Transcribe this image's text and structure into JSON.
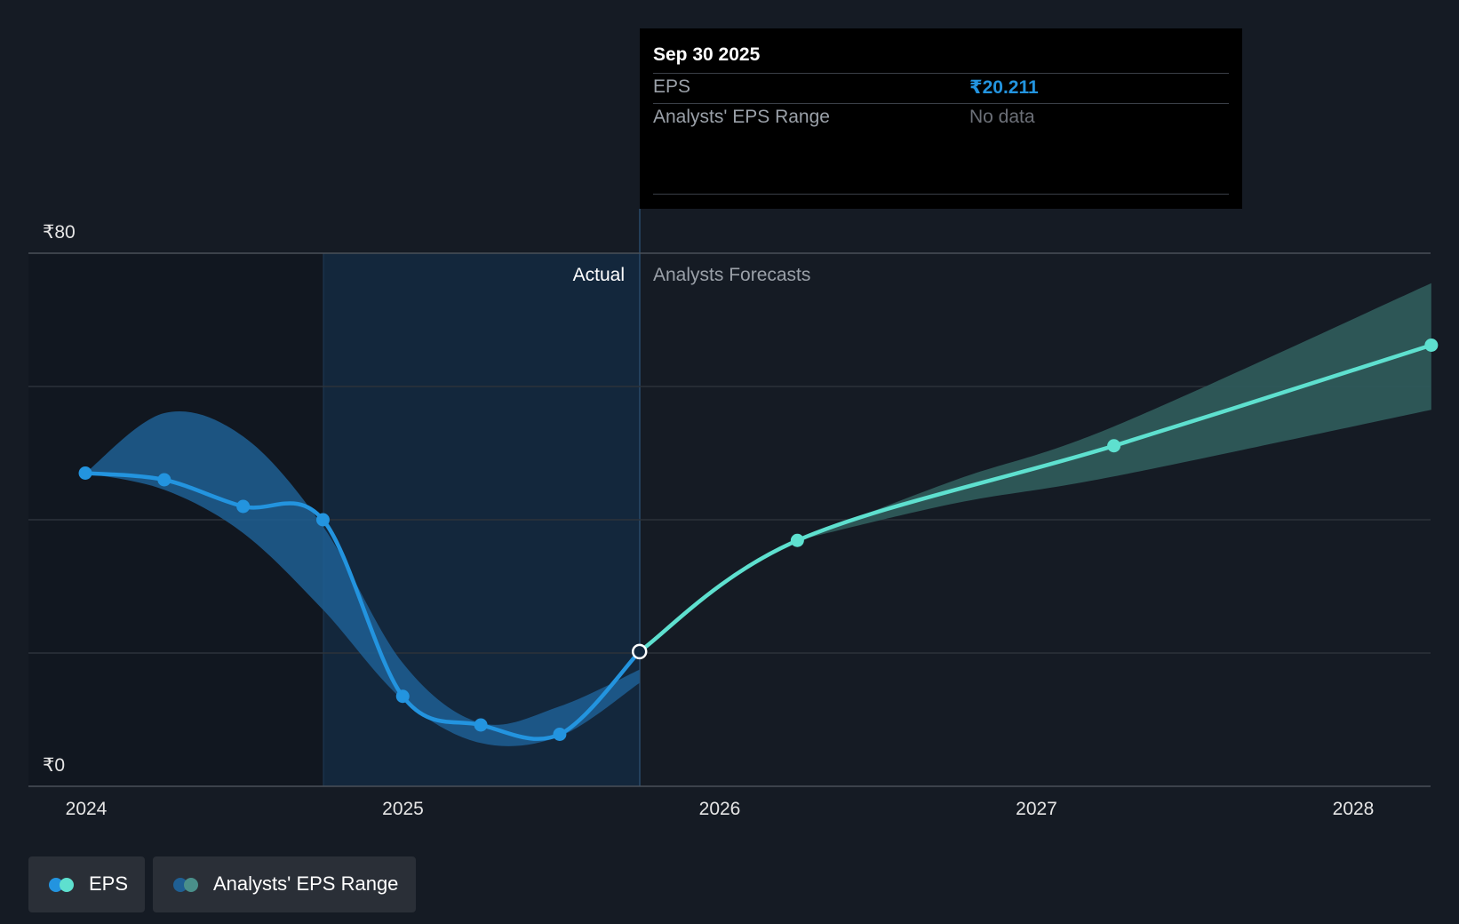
{
  "tooltip": {
    "date": "Sep 30 2025",
    "rows": [
      {
        "label": "EPS",
        "value": "₹20.211"
      },
      {
        "label": "Analysts' EPS Range",
        "value": "No data"
      }
    ]
  },
  "legend": {
    "eps_label": "EPS",
    "range_label": "Analysts' EPS Range"
  },
  "colors": {
    "background": "#151b24",
    "actual_line": "#2394df",
    "forecast_line": "#5ee0cf",
    "actual_range": "#1f5f93",
    "forecast_range": "#2e5a5a",
    "highlight_band": "#13273c"
  },
  "chart_data": {
    "type": "line",
    "title": "",
    "xlabel": "",
    "ylabel": "",
    "ylim": [
      0,
      80
    ],
    "y_ticks": [
      "₹80",
      "₹0"
    ],
    "x_ticks": [
      "2024",
      "2025",
      "2026",
      "2027",
      "2028"
    ],
    "grid": true,
    "region_labels": {
      "actual": "Actual",
      "forecast": "Analysts Forecasts"
    },
    "series": [
      {
        "name": "EPS",
        "segment": "actual",
        "points": [
          {
            "x": "2023-12-31",
            "y": 47.0
          },
          {
            "x": "2024-03-31",
            "y": 46.0
          },
          {
            "x": "2024-06-30",
            "y": 42.0
          },
          {
            "x": "2024-09-30",
            "y": 40.0
          },
          {
            "x": "2024-12-31",
            "y": 13.5
          },
          {
            "x": "2025-03-31",
            "y": 9.2
          },
          {
            "x": "2025-06-30",
            "y": 7.8
          },
          {
            "x": "2025-09-30",
            "y": 20.211
          }
        ]
      },
      {
        "name": "EPS",
        "segment": "forecast",
        "points": [
          {
            "x": "2025-09-30",
            "y": 20.211
          },
          {
            "x": "2026-03-31",
            "y": 36.9
          },
          {
            "x": "2027-03-31",
            "y": 51.1
          },
          {
            "x": "2028-03-31",
            "y": 66.2
          }
        ]
      }
    ],
    "ranges": [
      {
        "name": "Analysts' EPS Range",
        "segment": "actual",
        "points": [
          {
            "x": "2023-12-31",
            "low": 47.0,
            "high": 47.0
          },
          {
            "x": "2024-03-31",
            "low": 44.5,
            "high": 56.0
          },
          {
            "x": "2024-06-30",
            "low": 38.0,
            "high": 52.5
          },
          {
            "x": "2024-09-30",
            "low": 26.5,
            "high": 39.0
          },
          {
            "x": "2024-12-31",
            "low": 13.0,
            "high": 18.5
          },
          {
            "x": "2025-03-31",
            "low": 6.5,
            "high": 9.5
          },
          {
            "x": "2025-06-30",
            "low": 7.5,
            "high": 12.0
          },
          {
            "x": "2025-09-30",
            "low": 15.5,
            "high": 17.5
          }
        ]
      },
      {
        "name": "Analysts' EPS Range",
        "segment": "forecast",
        "points": [
          {
            "x": "2026-03-31",
            "low": 36.9,
            "high": 36.9
          },
          {
            "x": "2026-09-30",
            "low": 42.5,
            "high": 46.0
          },
          {
            "x": "2027-03-31",
            "low": 46.5,
            "high": 54.0
          },
          {
            "x": "2028-03-31",
            "low": 56.5,
            "high": 75.5
          }
        ]
      }
    ]
  }
}
